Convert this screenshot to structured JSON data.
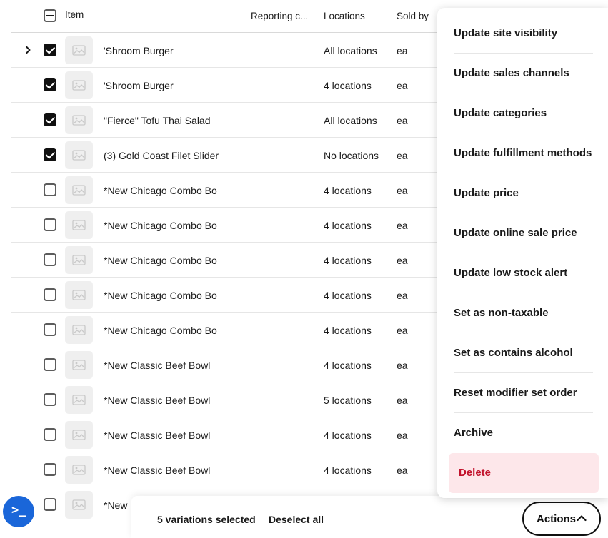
{
  "table": {
    "headers": {
      "item": "Item",
      "reporting": "Reporting c...",
      "locations": "Locations",
      "sold_by": "Sold by"
    },
    "rows": [
      {
        "name": "'Shroom Burger",
        "locations": "All locations",
        "unit": "ea",
        "checked": true,
        "expandable": true
      },
      {
        "name": "'Shroom Burger",
        "locations": "4 locations",
        "unit": "ea",
        "checked": true
      },
      {
        "name": "\"Fierce\" Tofu Thai Salad",
        "locations": "All locations",
        "unit": "ea",
        "checked": true
      },
      {
        "name": "(3) Gold Coast Filet Slider",
        "locations": "No locations",
        "unit": "ea",
        "checked": true
      },
      {
        "name": "*New Chicago Combo Bo",
        "locations": "4 locations",
        "unit": "ea",
        "checked": false
      },
      {
        "name": "*New Chicago Combo Bo",
        "locations": "4 locations",
        "unit": "ea",
        "checked": false
      },
      {
        "name": "*New Chicago Combo Bo",
        "locations": "4 locations",
        "unit": "ea",
        "checked": false
      },
      {
        "name": "*New Chicago Combo Bo",
        "locations": "4 locations",
        "unit": "ea",
        "checked": false
      },
      {
        "name": "*New Chicago Combo Bo",
        "locations": "4 locations",
        "unit": "ea",
        "checked": false
      },
      {
        "name": "*New Classic Beef Bowl",
        "locations": "4 locations",
        "unit": "ea",
        "checked": false
      },
      {
        "name": "*New Classic Beef Bowl",
        "locations": "5 locations",
        "unit": "ea",
        "checked": false
      },
      {
        "name": "*New Classic Beef Bowl",
        "locations": "4 locations",
        "unit": "ea",
        "checked": false
      },
      {
        "name": "*New Classic Beef Bowl",
        "locations": "4 locations",
        "unit": "ea",
        "checked": false
      },
      {
        "name": "*New C",
        "locations": "",
        "unit": "",
        "checked": false
      }
    ]
  },
  "menu": {
    "items": [
      "Update site visibility",
      "Update sales channels",
      "Update categories",
      "Update fulfillment methods",
      "Update price",
      "Update online sale price",
      "Update low stock alert",
      "Set as non-taxable",
      "Set as contains alcohol",
      "Reset modifier set order",
      "Archive"
    ],
    "delete_label": "Delete"
  },
  "bottombar": {
    "selected_text": "5 variations selected",
    "deselect_label": "Deselect all",
    "actions_label": "Actions"
  },
  "fab": {
    "symbol": ">_"
  },
  "colors": {
    "accent": "#1a66d9",
    "delete_bg": "#fde7ea",
    "delete_text": "#c2132c"
  }
}
